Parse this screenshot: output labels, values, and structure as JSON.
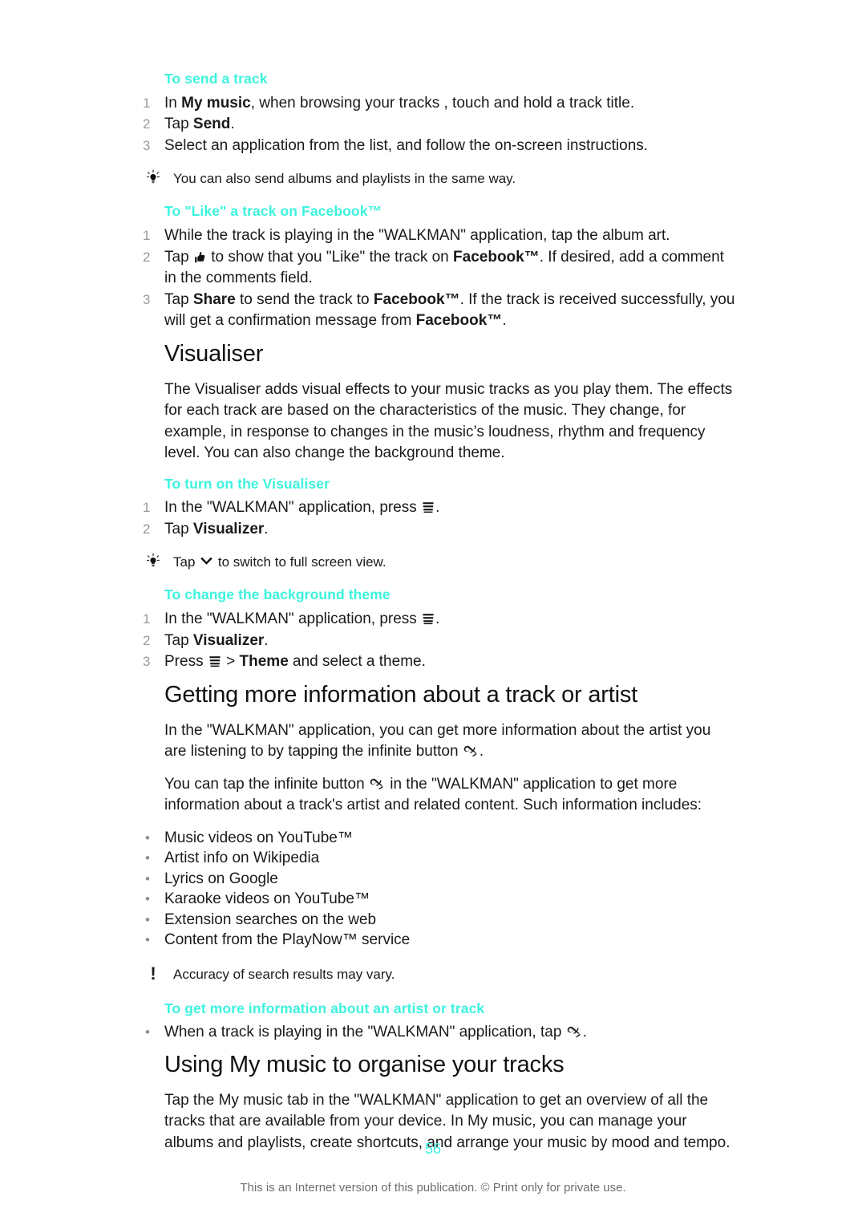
{
  "document": {
    "page_number": "56",
    "footer_note": "This is an Internet version of this publication. © Print only for private use."
  },
  "sections": {
    "send_track": {
      "heading": "To send a track",
      "steps": [
        {
          "num": "1",
          "pre": "In ",
          "bold": "My music",
          "post": ", when browsing your tracks , touch and hold a track title."
        },
        {
          "num": "2",
          "pre": "Tap ",
          "bold": "Send",
          "post": "."
        },
        {
          "num": "3",
          "pre": "Select an application from the list, and follow the on-screen instructions.",
          "bold": "",
          "post": ""
        }
      ],
      "tip": "You can also send albums and playlists in the same way."
    },
    "like_track": {
      "heading": "To \"Like\" a track on Facebook™",
      "step1": "While the track is playing in the \"WALKMAN\" application, tap the album art.",
      "step1_num": "1",
      "step2_num": "2",
      "step2_a": "Tap ",
      "step2_b": " to show that you \"Like\" the track on ",
      "step2_bold": "Facebook™",
      "step2_c": ". If desired, add a comment in the comments field.",
      "step3_num": "3",
      "step3_a": "Tap ",
      "step3_bold1": "Share",
      "step3_b": " to send the track to ",
      "step3_bold2": "Facebook™",
      "step3_c": ". If the track is received successfully, you will get a confirmation message from ",
      "step3_bold3": "Facebook™",
      "step3_d": "."
    },
    "visualiser": {
      "title": "Visualiser",
      "paragraph": "The Visualiser adds visual effects to your music tracks as you play them. The effects for each track are based on the characteristics of the music. They change, for example, in response to changes in the music’s loudness, rhythm and frequency level. You can also change the background theme.",
      "turn_on": {
        "heading": "To turn on the Visualiser",
        "step1_num": "1",
        "step1_a": "In the \"WALKMAN\" application, press ",
        "step1_b": ".",
        "step2_num": "2",
        "step2_a": "Tap ",
        "step2_bold": "Visualizer",
        "step2_b": ".",
        "tip_a": "Tap ",
        "tip_b": " to switch to full screen view."
      },
      "change_theme": {
        "heading": "To change the background theme",
        "step1_num": "1",
        "step1_a": "In the \"WALKMAN\" application, press ",
        "step1_b": ".",
        "step2_num": "2",
        "step2_a": "Tap ",
        "step2_bold": "Visualizer",
        "step2_b": ".",
        "step3_num": "3",
        "step3_a": "Press ",
        "step3_b": " > ",
        "step3_bold": "Theme",
        "step3_c": " and select a theme."
      }
    },
    "getting_more_info": {
      "title": "Getting more information about a track or artist",
      "para1_a": "In the \"WALKMAN\" application, you can get more information about the artist you are listening to by tapping the infinite button ",
      "para1_b": ".",
      "para2_a": "You can tap the infinite button ",
      "para2_b": " in the \"WALKMAN\" application to get more information about a track's artist and related content. Such information includes:",
      "bullets": [
        "Music videos on YouTube™",
        "Artist info on Wikipedia",
        "Lyrics on Google",
        "Karaoke videos on YouTube™",
        "Extension searches on the web",
        "Content from the PlayNow™ service"
      ],
      "note": "Accuracy of search results may vary.",
      "get_more": {
        "heading": "To get more information about an artist or track",
        "bullet_a": "When a track is playing in the \"WALKMAN\" application, tap ",
        "bullet_b": "."
      }
    },
    "using_my_music": {
      "title": "Using My music to organise your tracks",
      "paragraph": "Tap the My music tab in the \"WALKMAN\" application to get an overview of all the tracks that are available from your device. In My music, you can manage your albums and playlists, create shortcuts, and arrange your music by mood and tempo."
    }
  },
  "icons": {
    "menu": "menu-icon",
    "chevron_down": "chevron-down-icon",
    "infinite": "infinite-button-icon",
    "thumbs_up": "thumbs-up-icon",
    "tip_bulb": "light-bulb-icon",
    "note_exclamation": "exclamation-icon",
    "bullet": "•"
  },
  "colors": {
    "accent": "#3df3de",
    "body_text": "#1a1a1a",
    "muted": "#9a9a9a"
  }
}
